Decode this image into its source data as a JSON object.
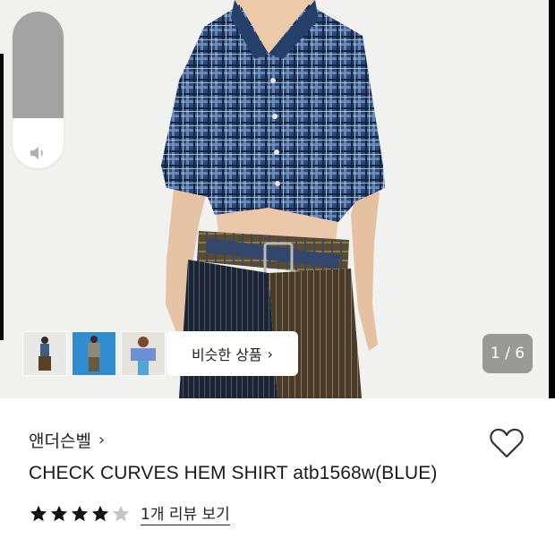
{
  "volume": {
    "level": 0.68,
    "icon": "speaker-icon"
  },
  "gallery": {
    "thumbnails": [
      {
        "name": "thumb-1",
        "bg": "#e8e8e6"
      },
      {
        "name": "thumb-2",
        "bg": "#2f8ccf"
      },
      {
        "name": "thumb-3",
        "bg": "#e4e2dc"
      }
    ],
    "similar_label": "비슷한 상품",
    "counter": "1 / 6"
  },
  "product": {
    "brand": "앤더슨벨",
    "title": "CHECK CURVES HEM SHIRT atb1568w(BLUE)",
    "rating": 4,
    "rating_max": 5,
    "review_link": "1개 리뷰 보기",
    "price_partial": "..."
  },
  "colors": {
    "star_filled": "#111111",
    "star_empty": "#c4c4c4",
    "counter_bg": "#585858"
  }
}
